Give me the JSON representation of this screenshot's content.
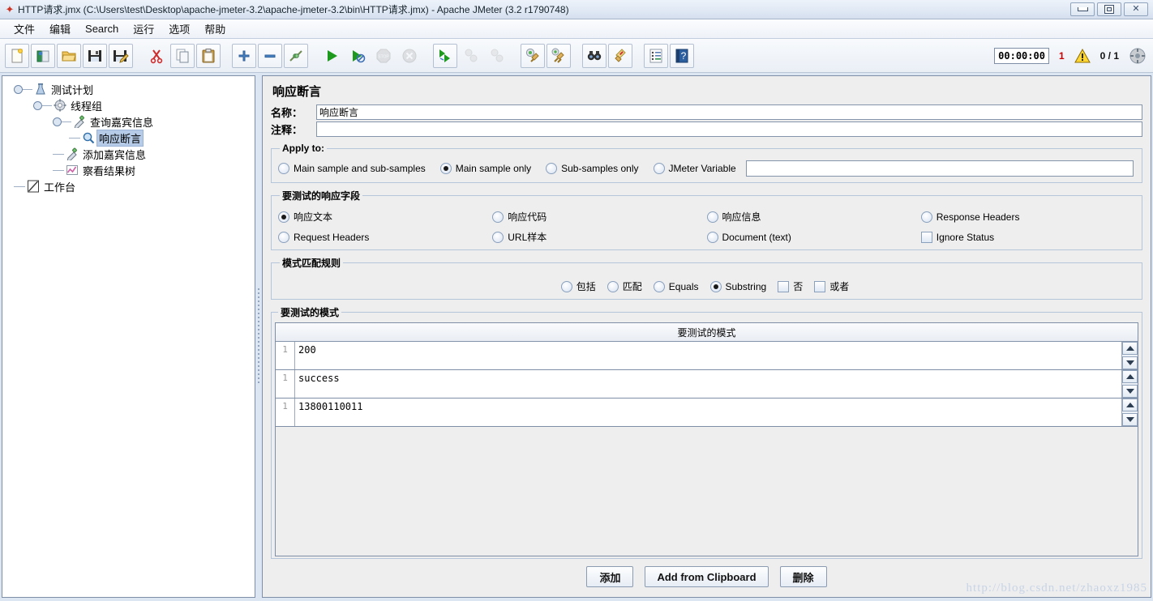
{
  "window": {
    "title": "HTTP请求.jmx (C:\\Users\\test\\Desktop\\apache-jmeter-3.2\\apache-jmeter-3.2\\bin\\HTTP请求.jmx) - Apache JMeter (3.2 r1790748)",
    "app_icon": "jmeter-feather-icon",
    "controls": [
      {
        "name": "minimize-button",
        "glyph": "minimize"
      },
      {
        "name": "restore-button",
        "glyph": "restore"
      },
      {
        "name": "close-button",
        "glyph": "close"
      }
    ]
  },
  "menubar": {
    "items": [
      {
        "label": "文件"
      },
      {
        "label": "编辑"
      },
      {
        "label": "Search"
      },
      {
        "label": "运行"
      },
      {
        "label": "选项"
      },
      {
        "label": "帮助"
      }
    ]
  },
  "toolbar": {
    "buttons": [
      {
        "name": "new-button",
        "icon": "new-document-icon",
        "enabled": true
      },
      {
        "name": "templates-button",
        "icon": "templates-icon",
        "enabled": true
      },
      {
        "name": "open-button",
        "icon": "open-folder-icon",
        "enabled": true
      },
      {
        "name": "save-button",
        "icon": "floppy-save-icon",
        "enabled": true
      },
      {
        "name": "save-as-button",
        "icon": "save-as-icon",
        "enabled": true
      },
      {
        "name": "cut-button",
        "icon": "scissors-icon",
        "enabled": true
      },
      {
        "name": "copy-button",
        "icon": "copy-icon",
        "enabled": true
      },
      {
        "name": "paste-button",
        "icon": "clipboard-paste-icon",
        "enabled": true
      },
      {
        "name": "expand-all-button",
        "icon": "plus-icon",
        "enabled": true
      },
      {
        "name": "collapse-all-button",
        "icon": "minus-icon",
        "enabled": true
      },
      {
        "name": "toggle-button",
        "icon": "toggle-pins-icon",
        "enabled": true
      },
      {
        "name": "start-button",
        "icon": "play-green-icon",
        "enabled": true
      },
      {
        "name": "start-no-timers-button",
        "icon": "play-no-timers-icon",
        "enabled": true
      },
      {
        "name": "stop-button",
        "icon": "stop-sign-icon",
        "enabled": false
      },
      {
        "name": "shutdown-button",
        "icon": "shutdown-x-icon",
        "enabled": false
      },
      {
        "name": "remote-start-all-button",
        "icon": "remote-start-icon",
        "enabled": true
      },
      {
        "name": "remote-stop-all-button",
        "icon": "remote-stop-icon",
        "enabled": false
      },
      {
        "name": "remote-shutdown-all-button",
        "icon": "remote-shutdown-icon",
        "enabled": false
      },
      {
        "name": "clear-button",
        "icon": "clear-broom-icon",
        "enabled": true
      },
      {
        "name": "clear-all-button",
        "icon": "clear-all-broom-icon",
        "enabled": true
      },
      {
        "name": "search-button",
        "icon": "binoculars-icon",
        "enabled": true
      },
      {
        "name": "reset-search-button",
        "icon": "reset-search-broom-icon",
        "enabled": true
      },
      {
        "name": "function-helper-button",
        "icon": "function-helper-icon",
        "enabled": true
      },
      {
        "name": "help-button",
        "icon": "help-book-icon",
        "enabled": true
      }
    ],
    "status": {
      "elapsed_time": "00:00:00",
      "warning_count": "1",
      "warning_icon": "warning-triangle-icon",
      "threads": "0 / 1",
      "activity_icon": "activity-circle-icon"
    }
  },
  "tree": {
    "nodes": [
      {
        "label": "测试计划",
        "icon": "test-plan-icon",
        "depth": 0,
        "selected": false,
        "expander": true
      },
      {
        "label": "线程组",
        "icon": "thread-group-icon",
        "depth": 1,
        "selected": false,
        "expander": true
      },
      {
        "label": "查询嘉宾信息",
        "icon": "http-sampler-icon",
        "depth": 2,
        "selected": false,
        "expander": true
      },
      {
        "label": "响应断言",
        "icon": "assertion-magnifier-icon",
        "depth": 3,
        "selected": true,
        "expander": false
      },
      {
        "label": "添加嘉宾信息",
        "icon": "http-sampler-icon",
        "depth": 2,
        "selected": false,
        "expander": false
      },
      {
        "label": "察看结果树",
        "icon": "view-results-tree-icon",
        "depth": 2,
        "selected": false,
        "expander": false
      },
      {
        "label": "工作台",
        "icon": "workbench-icon",
        "depth": 0,
        "selected": false,
        "expander": false
      }
    ]
  },
  "panel": {
    "title": "响应断言",
    "name_label": "名称：",
    "name_value": "响应断言",
    "comment_label": "注释：",
    "comment_value": "",
    "apply_to": {
      "legend": "Apply to:",
      "options": [
        {
          "label": "Main sample and sub-samples",
          "selected": false
        },
        {
          "label": "Main sample only",
          "selected": true
        },
        {
          "label": "Sub-samples only",
          "selected": false
        },
        {
          "label": "JMeter Variable",
          "selected": false
        }
      ],
      "variable_value": ""
    },
    "response_field": {
      "legend": "要测试的响应字段",
      "options": [
        {
          "label": "响应文本",
          "selected": true,
          "type": "radio"
        },
        {
          "label": "响应代码",
          "selected": false,
          "type": "radio"
        },
        {
          "label": "响应信息",
          "selected": false,
          "type": "radio"
        },
        {
          "label": "Response Headers",
          "selected": false,
          "type": "radio"
        },
        {
          "label": "Request Headers",
          "selected": false,
          "type": "radio"
        },
        {
          "label": "URL样本",
          "selected": false,
          "type": "radio"
        },
        {
          "label": "Document (text)",
          "selected": false,
          "type": "radio"
        },
        {
          "label": "Ignore Status",
          "selected": false,
          "type": "checkbox"
        }
      ]
    },
    "pattern_rules": {
      "legend": "模式匹配规则",
      "options": [
        {
          "label": "包括",
          "selected": false,
          "type": "radio"
        },
        {
          "label": "匹配",
          "selected": false,
          "type": "radio"
        },
        {
          "label": "Equals",
          "selected": false,
          "type": "radio"
        },
        {
          "label": "Substring",
          "selected": true,
          "type": "radio"
        },
        {
          "label": "否",
          "selected": false,
          "type": "checkbox"
        },
        {
          "label": "或者",
          "selected": false,
          "type": "checkbox"
        }
      ]
    },
    "patterns": {
      "legend": "要测试的模式",
      "column_header": "要测试的模式",
      "rows": [
        {
          "line_no": "1",
          "value": "200"
        },
        {
          "line_no": "1",
          "value": "success"
        },
        {
          "line_no": "1",
          "value": "13800110011"
        }
      ]
    },
    "buttons": [
      {
        "name": "add-pattern-button",
        "label": "添加"
      },
      {
        "name": "add-from-clipboard-button",
        "label": "Add from Clipboard"
      },
      {
        "name": "delete-pattern-button",
        "label": "删除"
      }
    ]
  },
  "watermark": "http://blog.csdn.net/zhaoxz1985"
}
